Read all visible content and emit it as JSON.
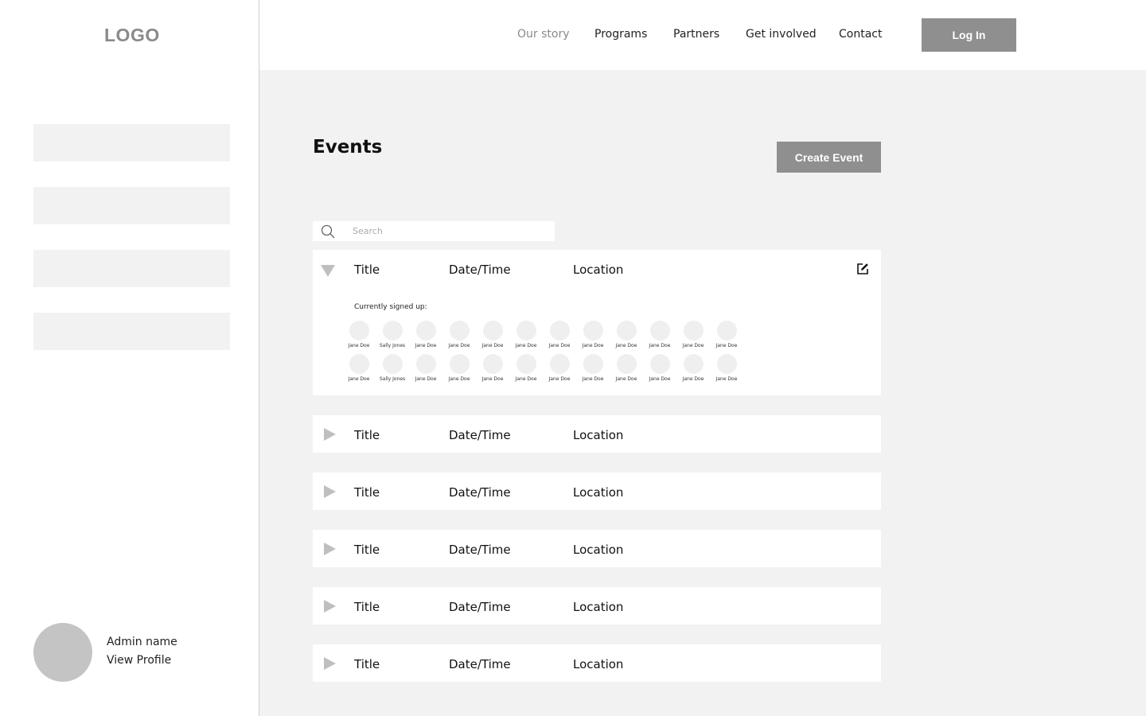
{
  "sidebar": {
    "logo": "LOGO",
    "admin": {
      "name": "Admin name",
      "view_profile": "View Profile"
    }
  },
  "nav": {
    "links": [
      "Our story",
      "Programs",
      "Partners",
      "Get involved",
      "Contact"
    ],
    "active_index": 0,
    "login_label": "Log In"
  },
  "events": {
    "title": "Events",
    "create_label": "Create Event",
    "search_placeholder": "Search",
    "rows": [
      {
        "title": "Title",
        "datetime": "Date/Time",
        "location": "Location",
        "expanded": true,
        "signed_label": "Currently signed up:",
        "attendees": [
          [
            "Jane Doe",
            "Sally Jones",
            "Jane Doe",
            "Jane Doe",
            "Jane Doe",
            "Jane Doe",
            "Jane Doe",
            "Jane Doe",
            "Jane Doe",
            "Jane Doe",
            "Jane Doe",
            "Jane Doe"
          ],
          [
            "Jane Doe",
            "Sally Jones",
            "Jane Doe",
            "Jane Doe",
            "Jane Doe",
            "Jane Doe",
            "Jane Doe",
            "Jane Doe",
            "Jane Doe",
            "Jane Doe",
            "Jane Doe",
            "Jane Doe"
          ]
        ]
      },
      {
        "title": "Title",
        "datetime": "Date/Time",
        "location": "Location",
        "expanded": false
      },
      {
        "title": "Title",
        "datetime": "Date/Time",
        "location": "Location",
        "expanded": false
      },
      {
        "title": "Title",
        "datetime": "Date/Time",
        "location": "Location",
        "expanded": false
      },
      {
        "title": "Title",
        "datetime": "Date/Time",
        "location": "Location",
        "expanded": false
      },
      {
        "title": "Title",
        "datetime": "Date/Time",
        "location": "Location",
        "expanded": false
      }
    ]
  },
  "icons": {
    "search": "search-icon",
    "edit": "edit-icon",
    "expand_open": "triangle-down-icon",
    "expand_closed": "triangle-right-icon"
  },
  "colors": {
    "button": "#8f8f8f",
    "panel": "#f2f2f2",
    "placeholder_block": "#f2f2f2",
    "avatar": "#c4c4c4"
  }
}
